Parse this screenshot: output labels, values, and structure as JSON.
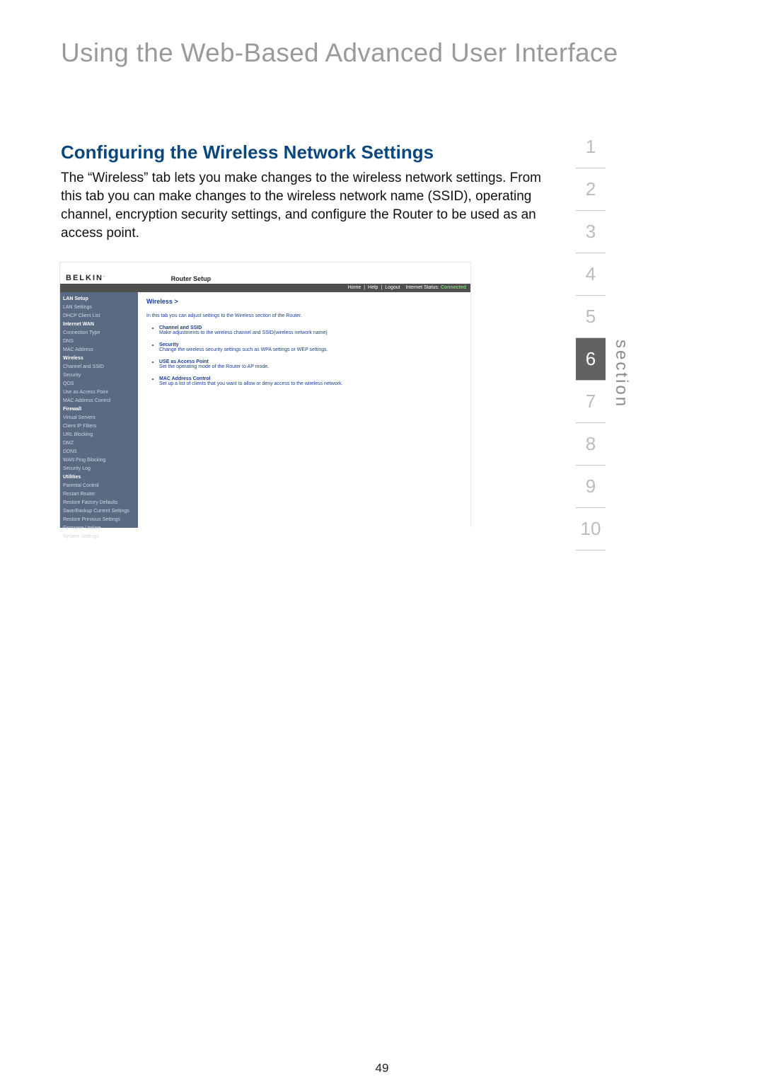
{
  "page": {
    "header": "Using the Web-Based Advanced User Interface",
    "section_title": "Configuring the Wireless Network Settings",
    "body": "The “Wireless” tab lets you make changes to the wireless network settings. From this tab you can make changes to the wireless network name (SSID), operating channel, encryption security settings, and configure the Router to be used as an access point.",
    "page_number": "49",
    "section_label": "section"
  },
  "section_nav": {
    "items": [
      "1",
      "2",
      "3",
      "4",
      "5",
      "6",
      "7",
      "8",
      "9",
      "10"
    ],
    "active": "6"
  },
  "router": {
    "logo": "BELKIN",
    "logo_sub": ".",
    "title": "Router Setup",
    "statusbar": {
      "home": "Home",
      "help": "Help",
      "logout": "Logout",
      "status_label": "Internet Status:",
      "status_value": "Connected"
    },
    "sidebar": [
      {
        "label": "LAN Setup",
        "header": true
      },
      {
        "label": "LAN Settings",
        "header": false
      },
      {
        "label": "DHCP Client List",
        "header": false
      },
      {
        "label": "Internet WAN",
        "header": true
      },
      {
        "label": "Connection Type",
        "header": false
      },
      {
        "label": "DNS",
        "header": false
      },
      {
        "label": "MAC Address",
        "header": false
      },
      {
        "label": "Wireless",
        "header": true
      },
      {
        "label": "Channel and SSID",
        "header": false
      },
      {
        "label": "Security",
        "header": false
      },
      {
        "label": "QOS",
        "header": false
      },
      {
        "label": "Use as Access Point",
        "header": false
      },
      {
        "label": "MAC Address Control",
        "header": false
      },
      {
        "label": "Firewall",
        "header": true
      },
      {
        "label": "Virtual Servers",
        "header": false
      },
      {
        "label": "Client IP Filters",
        "header": false
      },
      {
        "label": "URL Blocking",
        "header": false
      },
      {
        "label": "DMZ",
        "header": false
      },
      {
        "label": "DDNS",
        "header": false
      },
      {
        "label": "WAN Ping Blocking",
        "header": false
      },
      {
        "label": "Security Log",
        "header": false
      },
      {
        "label": "Utilities",
        "header": true
      },
      {
        "label": "Parental Control",
        "header": false
      },
      {
        "label": "Restart Router",
        "header": false
      },
      {
        "label": "Restore Factory Defaults",
        "header": false
      },
      {
        "label": "Save/Backup Current Settings",
        "header": false
      },
      {
        "label": "Restore Previous Settings",
        "header": false
      },
      {
        "label": "Firmware Update",
        "header": false
      },
      {
        "label": "System Settings",
        "header": false
      }
    ],
    "main": {
      "crumb": "Wireless >",
      "desc": "In this tab you can adjust settings to the Wireless section of the Router.",
      "bullets": [
        {
          "title": "Channel and SSID",
          "desc": "Make adjustments to the wireless channel and SSID(wireless network name)"
        },
        {
          "title": "Security",
          "desc": "Change the wireless security settings such as WPA settings or WEP settings."
        },
        {
          "title": "USE as Access Point",
          "desc": "Set the operating mode of the Router to AP mode."
        },
        {
          "title": "MAC Address Control",
          "desc": "Set up a list of clients that you want to allow or deny access to the wireless network."
        }
      ]
    }
  }
}
